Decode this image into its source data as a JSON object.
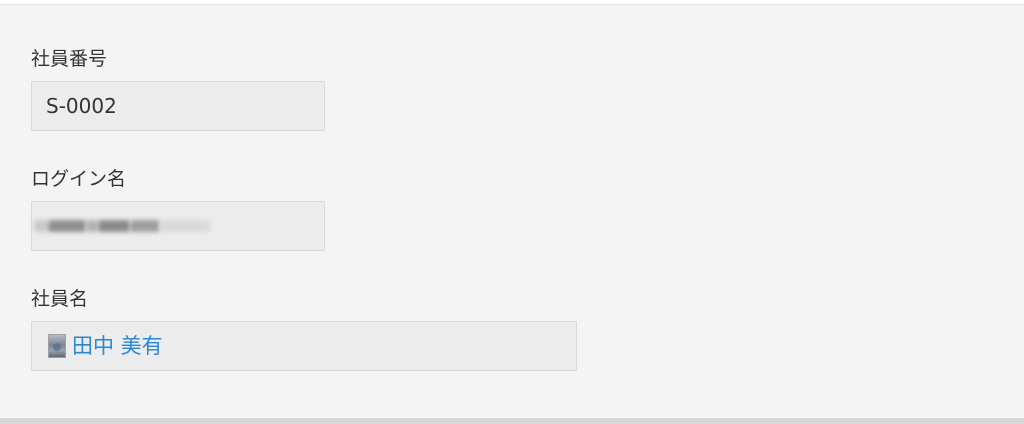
{
  "fields": {
    "employee_number": {
      "label": "社員番号",
      "value": "S-0002"
    },
    "login_name": {
      "label": "ログイン名"
    },
    "employee_name": {
      "label": "社員名",
      "value": "田中 美有",
      "avatar_icon": "user-avatar-icon"
    }
  },
  "colors": {
    "panel_bg": "#f4f4f4",
    "field_bg": "#ececec",
    "field_border": "#d9d9d9",
    "link": "#2a87d4",
    "text": "#333333"
  }
}
